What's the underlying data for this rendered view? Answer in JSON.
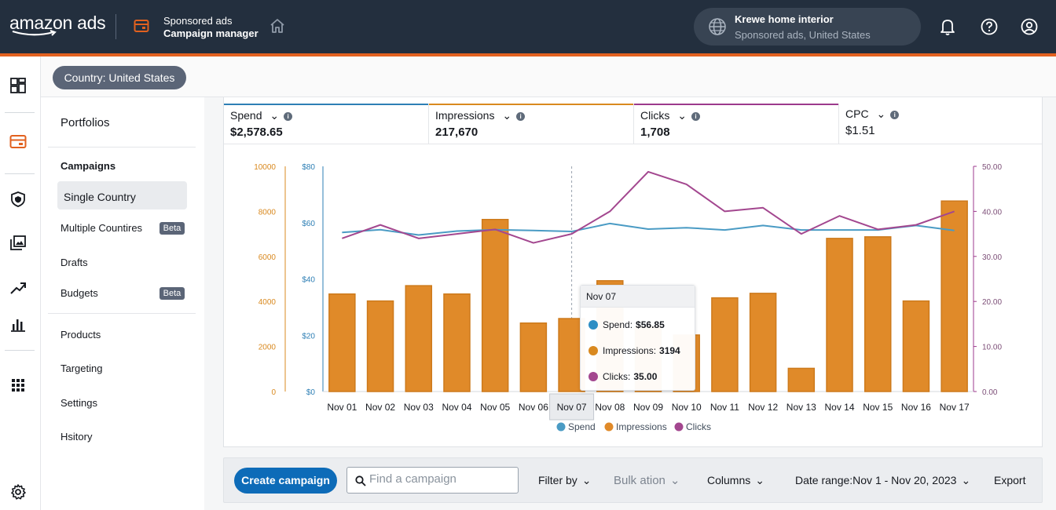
{
  "header": {
    "logo": "amazon ads",
    "app_line1": "Sponsored ads",
    "app_line2": "Campaign manager",
    "account_name": "Krewe home interior",
    "account_sub": "Sponsored ads, United States"
  },
  "country_pill": "Country: United States",
  "subnav": {
    "portfolios": "Portfolios",
    "campaigns": "Campaigns",
    "single_country": "Single Country",
    "multiple_countries": "Multiple Countires",
    "multiple_badge": "Beta",
    "drafts": "Drafts",
    "budgets": "Budgets",
    "budgets_badge": "Beta",
    "products": "Products",
    "targeting": "Targeting",
    "settings": "Settings",
    "history": "Hsitory"
  },
  "metrics": [
    {
      "label": "Spend",
      "value": "$2,578.65",
      "color": "#2e7fb5"
    },
    {
      "label": "Impressions",
      "value": "217,670",
      "color": "#d9891f"
    },
    {
      "label": "Clicks",
      "value": "1,708",
      "color": "#9c3a8c"
    },
    {
      "label": "CPC",
      "value": "$1.51",
      "color": "#ffffff"
    }
  ],
  "tooltip": {
    "title": "Nov 07",
    "spend_label": "Spend:",
    "spend_value": "$56.85",
    "impressions_label": "Impressions:",
    "impressions_value": "3194",
    "clicks_label": "Clicks:",
    "clicks_value": "35.00"
  },
  "chart_data": {
    "type": "bar",
    "categories": [
      "Nov 01",
      "Nov 02",
      "Nov 03",
      "Nov 04",
      "Nov 05",
      "Nov 06",
      "Nov 07",
      "Nov 08",
      "Nov 09",
      "Nov 10",
      "Nov 11",
      "Nov 12",
      "Nov 13",
      "Nov 14",
      "Nov 15",
      "Nov 16",
      "Nov 17"
    ],
    "highlighted_category": "Nov 07",
    "series": [
      {
        "name": "Impressions",
        "type": "bar",
        "axis": "left-impressions",
        "color": "#e08a29",
        "values": [
          4330,
          4020,
          4700,
          4330,
          7640,
          3040,
          3240,
          4920,
          2900,
          2510,
          4160,
          4360,
          1030,
          6800,
          6870,
          4020,
          8460
        ]
      },
      {
        "name": "Spend",
        "type": "line",
        "axis": "left-spend",
        "color": "#4a9bc4",
        "values": [
          56.5,
          57.5,
          55.6,
          57.0,
          57.5,
          57.2,
          56.85,
          59.7,
          57.7,
          58.2,
          57.4,
          59.0,
          57.4,
          57.4,
          57.4,
          59.0,
          57.2
        ]
      },
      {
        "name": "Clicks",
        "type": "line",
        "axis": "right",
        "color": "#a3478f",
        "values": [
          34.0,
          37.0,
          34.0,
          35.0,
          36.0,
          33.0,
          35.0,
          40.0,
          48.8,
          46.0,
          40.0,
          40.8,
          35.0,
          39.0,
          36.0,
          37.0,
          40.0
        ]
      }
    ],
    "axes": {
      "left_impressions": {
        "ticks": [
          "0",
          "2000",
          "4000",
          "6000",
          "8000",
          "10000"
        ],
        "range": [
          0,
          10000
        ],
        "color": "#d9891f"
      },
      "left_spend": {
        "ticks": [
          "$0",
          "$20",
          "$40",
          "$60",
          "$80"
        ],
        "range": [
          0,
          80
        ],
        "color": "#2e7fb5"
      },
      "right_clicks": {
        "ticks": [
          "0.00",
          "10.00",
          "20.00",
          "30.00",
          "40.00",
          "50.00"
        ],
        "range": [
          0,
          50
        ],
        "color": "#9c3a8c"
      }
    },
    "legend": [
      "Spend",
      "Impressions",
      "Clicks"
    ],
    "legend_position": "bottom-center"
  },
  "toolbar": {
    "create_label": "Create campaign",
    "search_placeholder": "Find a campaign",
    "filter_label": "Filter by",
    "bulk_label": "Bulk ation",
    "columns_label": "Columns",
    "date_range_label": "Date range:Nov 1 - Nov 20, 2023",
    "export_label": "Export"
  },
  "icons": {
    "nav": [
      "dashboard-icon",
      "campaign-icon",
      "shield-icon",
      "creative-icon",
      "trend-icon",
      "bar-chart-icon",
      "apps-grid-icon",
      "settings-gear-icon"
    ],
    "header": [
      "home-icon",
      "globe-icon",
      "bell-icon",
      "help-icon",
      "user-icon"
    ]
  }
}
